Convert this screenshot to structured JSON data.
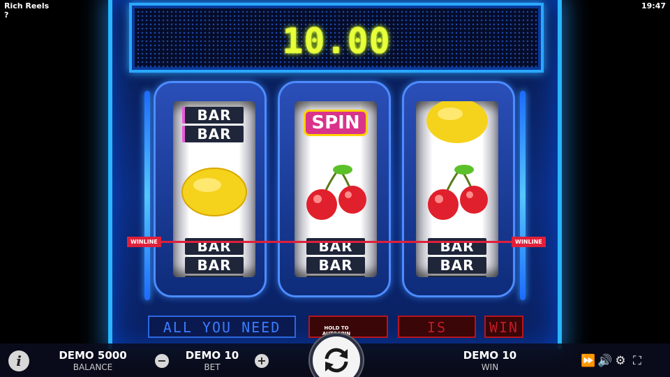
{
  "app": {
    "title": "Rich Reels",
    "help_label": "?",
    "clock": "19:47"
  },
  "display": {
    "win_amount": "10.00"
  },
  "reels": [
    {
      "top": "BAR BAR",
      "middle": "lemon",
      "bottom": "BAR BAR BAR"
    },
    {
      "top": "SPIN",
      "middle": "cherries",
      "bottom": "BAR BAR BAR"
    },
    {
      "top": "lemon",
      "middle": "cherries",
      "bottom": "BAR BAR BAR"
    }
  ],
  "symbols": {
    "bar": "BAR",
    "spin": "SPIN"
  },
  "winline": {
    "left_label": "WINLINE",
    "right_label": "WINLINE"
  },
  "led_panels": {
    "message": "ALL YOU NEED",
    "panel2": "",
    "panel3": "IS",
    "panel4": "WIN"
  },
  "footer": {
    "balance_value": "DEMO 5000",
    "balance_label": "BALANCE",
    "bet_value": "DEMO 10",
    "bet_label": "BET",
    "win_value": "DEMO 10",
    "win_label": "WIN",
    "autospin_hint": "HOLD TO AUTOSPIN",
    "info_icon": "i",
    "minus_label": "−",
    "plus_label": "+"
  },
  "icons": [
    "turbo-icon",
    "sound-icon",
    "settings-icon",
    "fullscreen-icon"
  ],
  "colors": {
    "accent": "#27b6ff",
    "led_yellow": "#e8ff3c",
    "winline_red": "#e0203a",
    "spin_pink": "#d9338a"
  }
}
